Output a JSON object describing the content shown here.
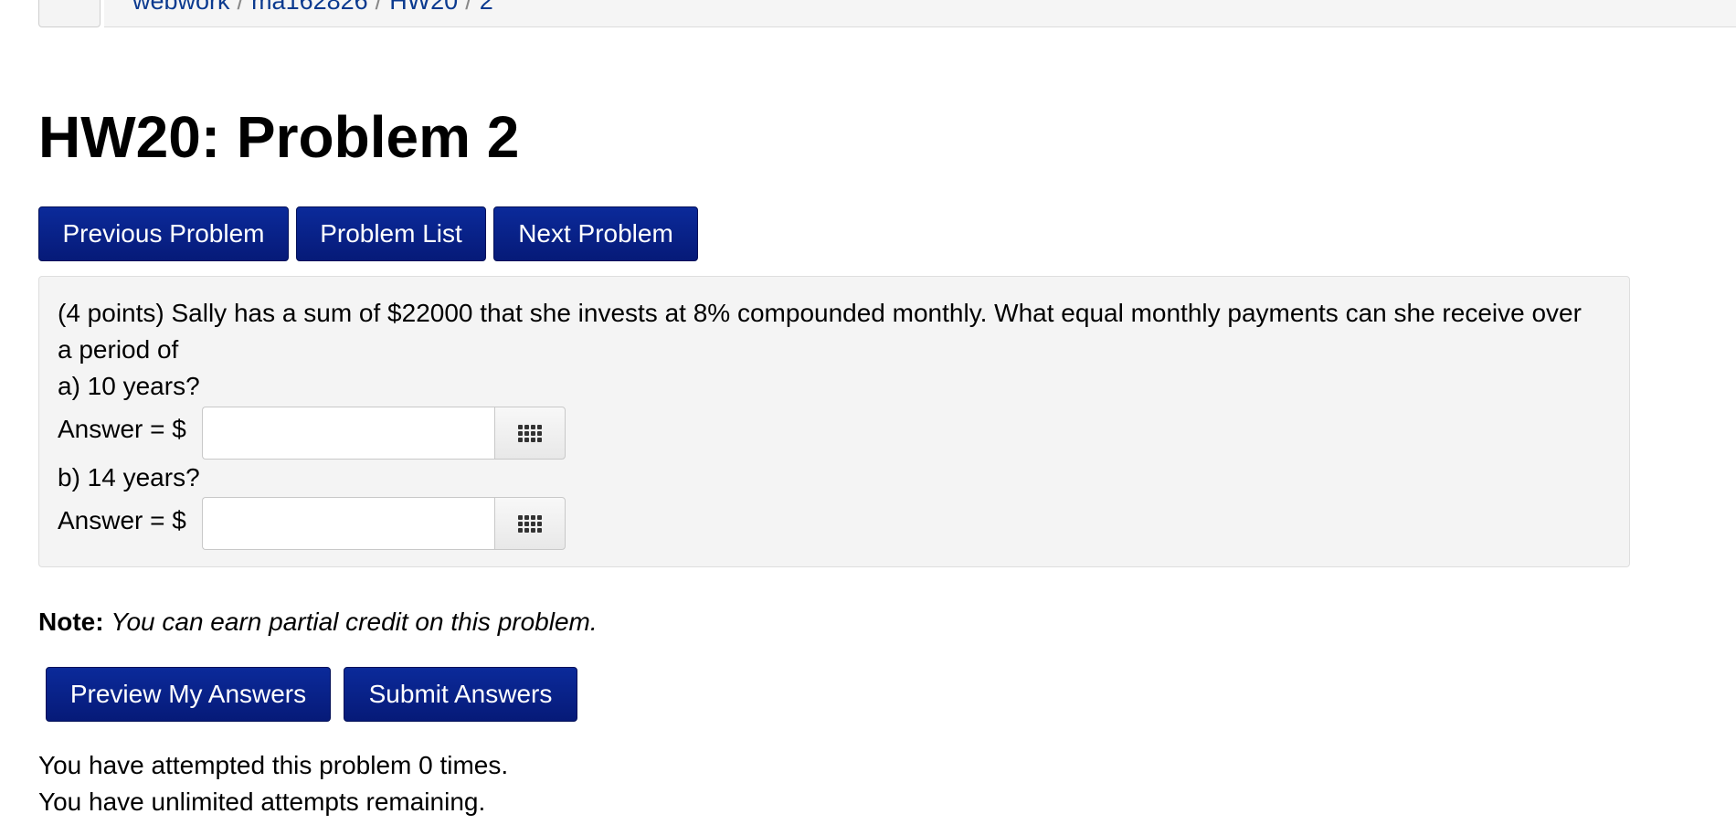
{
  "nav": {
    "back_icon": "chevron-left-icon",
    "back_glyph": "‹",
    "breadcrumb": [
      "webwork",
      "ma162826",
      "HW20",
      "2"
    ],
    "breadcrumb_separator": "/"
  },
  "title": "HW20: Problem 2",
  "problem_nav": {
    "previous_label": "Previous Problem",
    "list_label": "Problem List",
    "next_label": "Next Problem"
  },
  "problem": {
    "statement_line1": "(4 points) Sally has a sum of $22000 that she invests at 8% compounded monthly. What equal monthly payments can she receive over",
    "statement_line2": "a period of",
    "parts": [
      {
        "prompt": "a) 10 years?",
        "answer_label": "Answer = $",
        "value": "",
        "keypad_icon": "grid-icon"
      },
      {
        "prompt": "b) 14 years?",
        "answer_label": "Answer = $",
        "value": "",
        "keypad_icon": "grid-icon"
      }
    ]
  },
  "note": {
    "label": "Note:",
    "text": "You can earn partial credit on this problem."
  },
  "actions": {
    "preview_label": "Preview My Answers",
    "submit_label": "Submit Answers"
  },
  "status": {
    "attempts": "You have attempted this problem 0 times.",
    "remaining": "You have unlimited attempts remaining."
  },
  "colors": {
    "button": "#0b2a9a",
    "link": "#0b3a8f",
    "panel": "#f4f4f4"
  }
}
